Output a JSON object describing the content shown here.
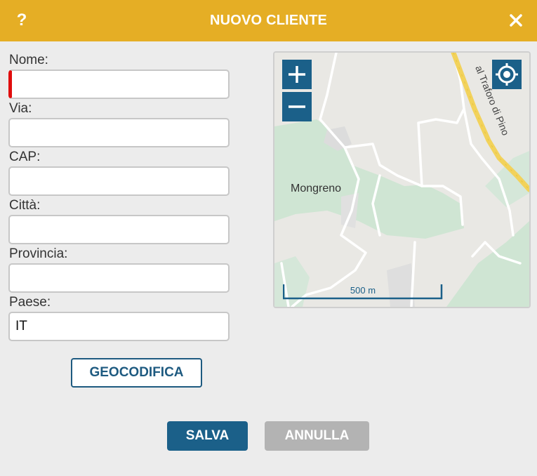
{
  "dialog": {
    "title": "NUOVO CLIENTE",
    "help_glyph": "?",
    "accent_color": "#e5ae25",
    "icons": {
      "help": "help-icon",
      "close": "close-icon"
    }
  },
  "form": {
    "nome_label": "Nome:",
    "nome_value": "",
    "via_label": "Via:",
    "via_value": "",
    "cap_label": "CAP:",
    "cap_value": "",
    "citta_label": "Città:",
    "citta_value": "",
    "provincia_label": "Provincia:",
    "provincia_value": "",
    "paese_label": "Paese:",
    "paese_value": "IT",
    "required_color": "#e00d0d"
  },
  "buttons": {
    "geocode": "GEOCODIFICA",
    "save": "SALVA",
    "cancel": "ANNULLA",
    "primary_color": "#1b6089",
    "disabled_color": "#b3b3b3"
  },
  "map": {
    "place_label": "Mongreno",
    "road_label": "al Traforo di Pino",
    "scale_label": "500 m",
    "icons": {
      "zoom_in": "plus-icon",
      "zoom_out": "minus-icon",
      "locate": "locate-icon"
    }
  }
}
